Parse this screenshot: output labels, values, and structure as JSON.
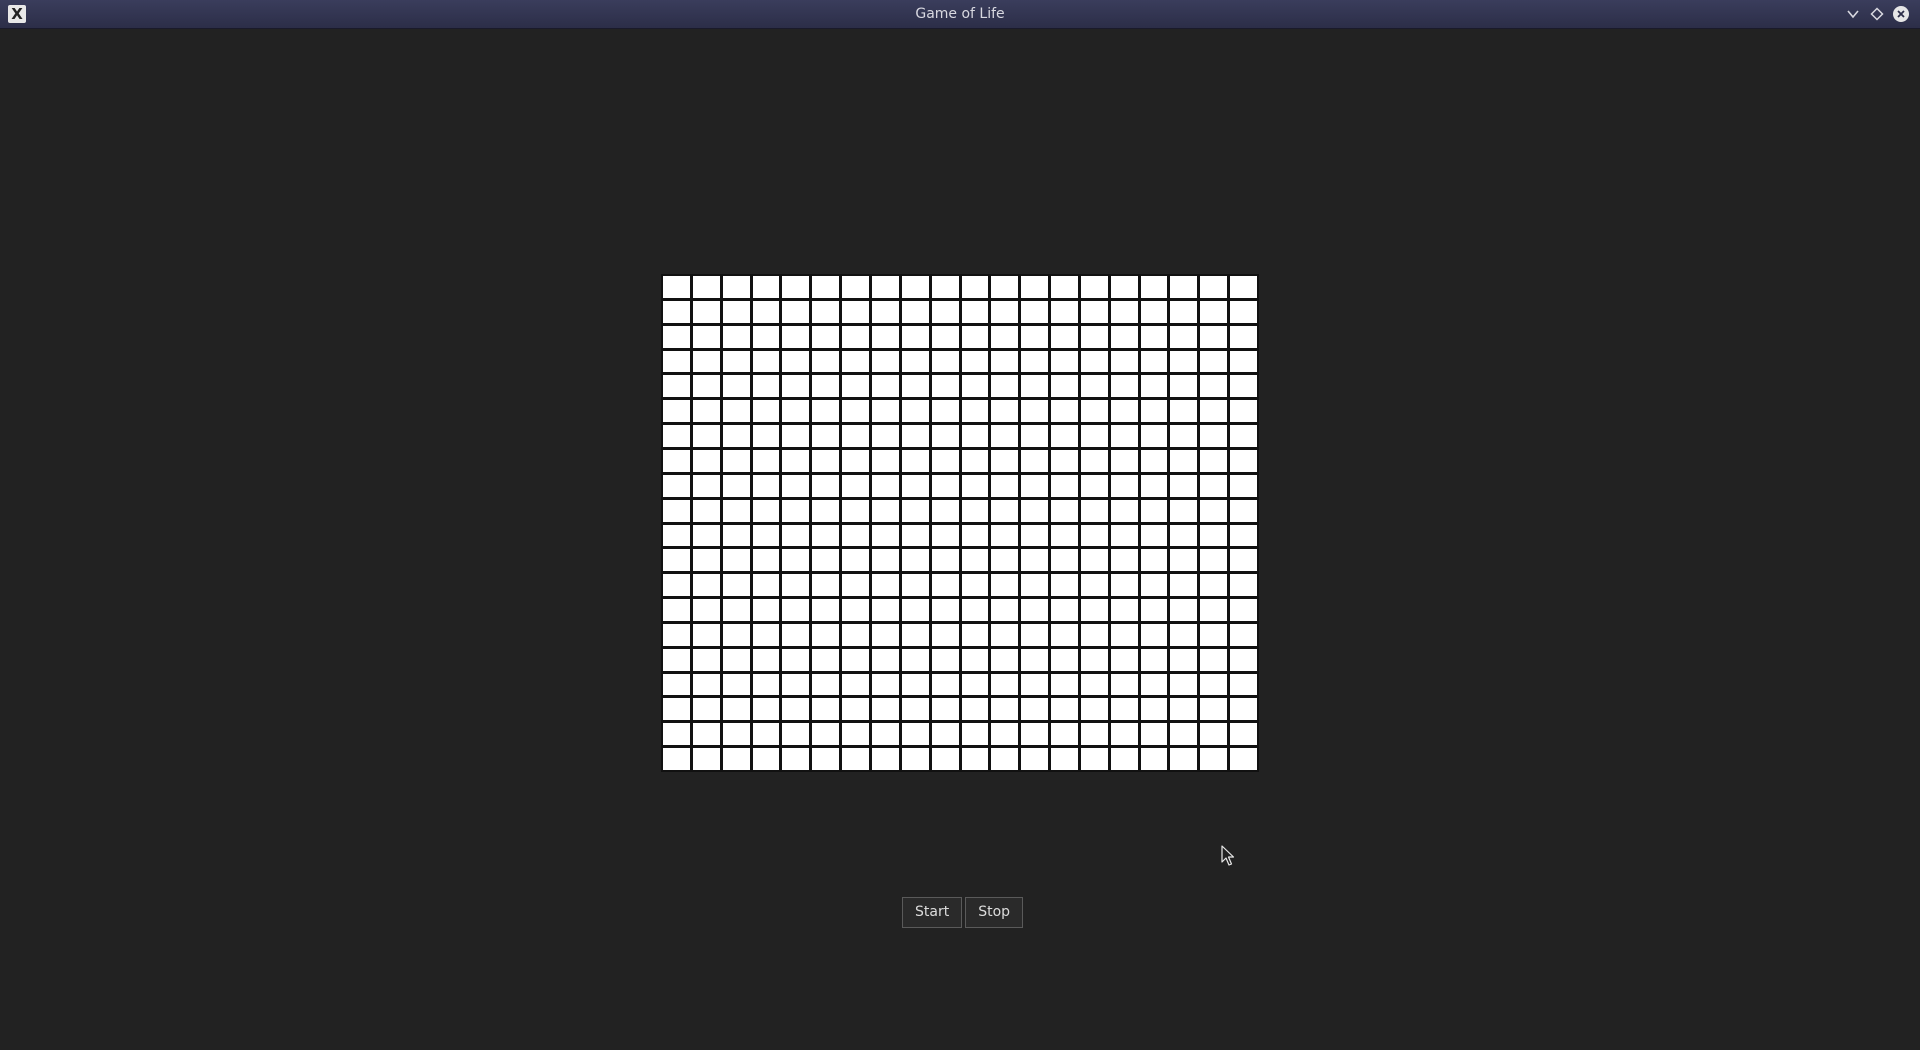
{
  "window": {
    "title": "Game of Life",
    "app_icon": "X"
  },
  "grid": {
    "rows": 20,
    "columns": 20,
    "alive_cells": [],
    "cell_color": "#ffffff",
    "line_color": "#111111"
  },
  "controls": {
    "start_label": "Start",
    "stop_label": "Stop"
  },
  "icons": {
    "minimize": "chevron-down-icon",
    "maximize": "diamond-icon",
    "close": "close-icon"
  },
  "colors": {
    "background": "#222222",
    "titlebar": "#34364f"
  }
}
